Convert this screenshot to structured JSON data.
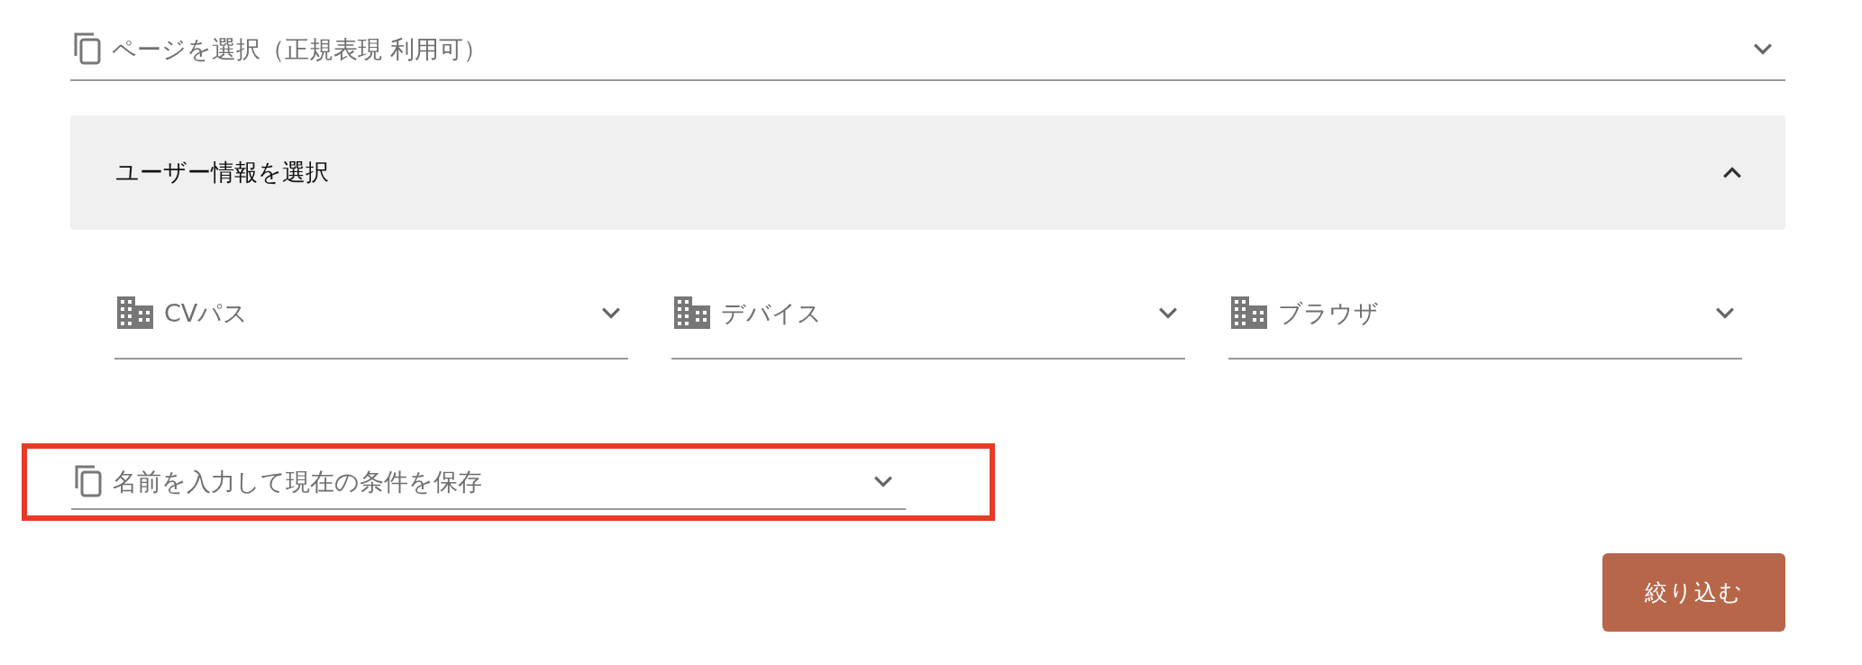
{
  "page_select": {
    "placeholder": "ページを選択（正規表現 利用可）"
  },
  "user_info_panel": {
    "title": "ユーザー情報を選択",
    "expanded": true,
    "filters": [
      {
        "placeholder": "CVパス"
      },
      {
        "placeholder": "デバイス"
      },
      {
        "placeholder": "ブラウザ"
      }
    ]
  },
  "save_condition": {
    "placeholder": "名前を入力して現在の条件を保存",
    "highlighted": true
  },
  "buttons": [
    "絞り込む"
  ]
}
